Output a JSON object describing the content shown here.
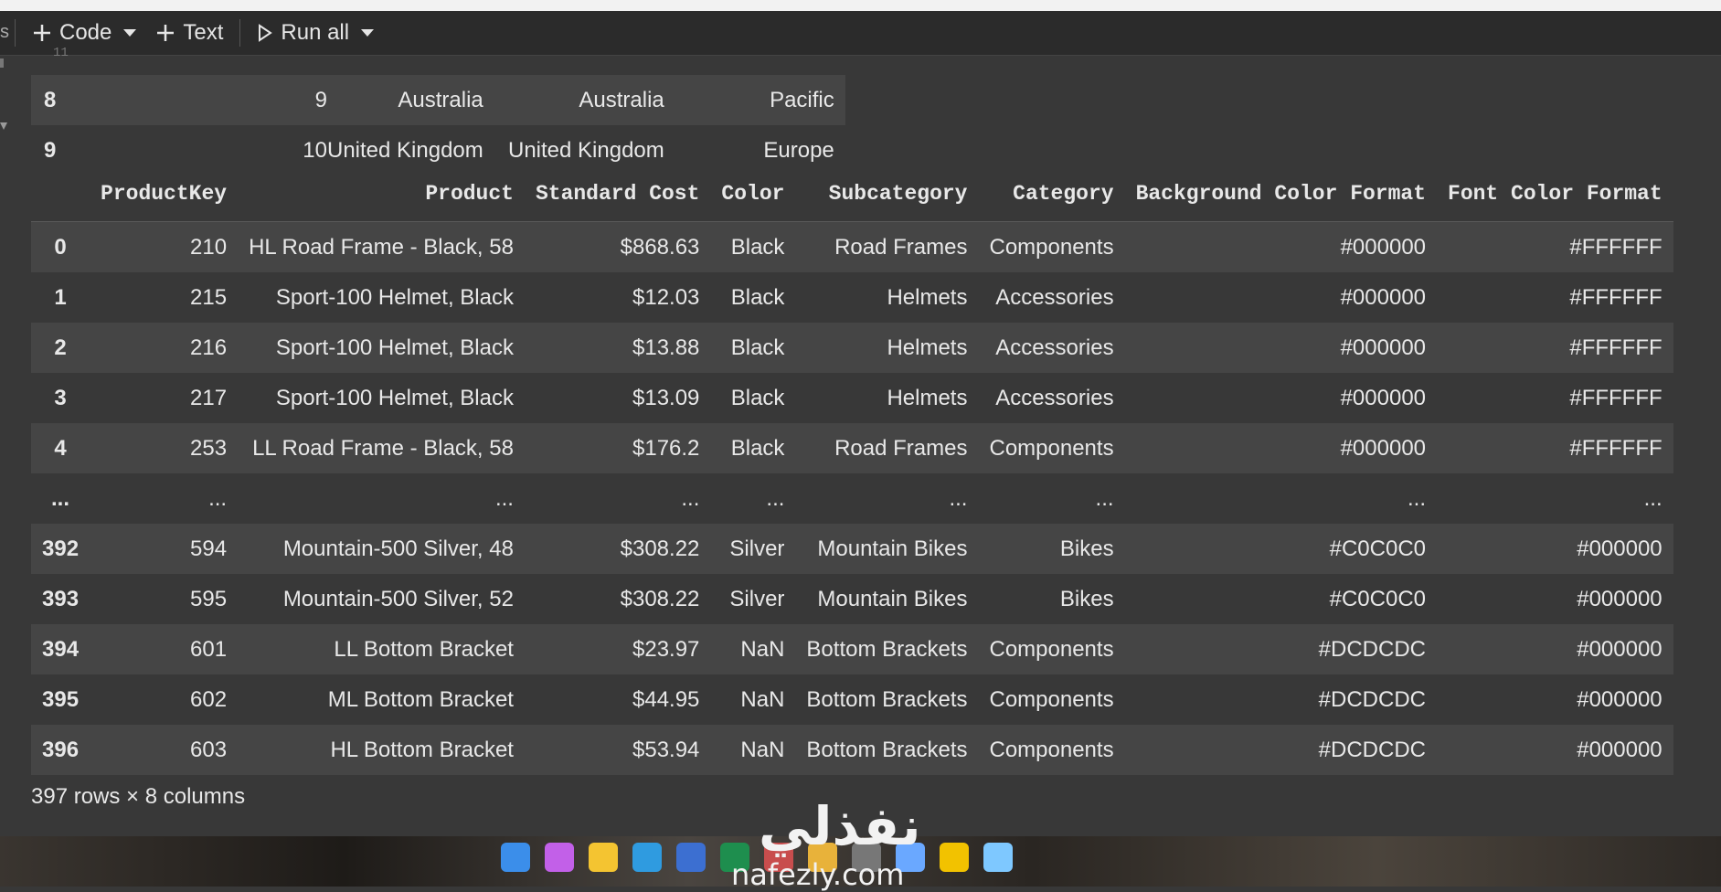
{
  "toolbar": {
    "code_label": "Code",
    "text_label": "Text",
    "run_all_label": "Run all",
    "edge_glyph": "s"
  },
  "cell_number": "11",
  "top_rows": [
    {
      "idx": "8",
      "key": "9",
      "country": "Australia",
      "region": "Australia",
      "group": "Pacific"
    },
    {
      "idx": "9",
      "key": "10",
      "country": "United Kingdom",
      "region": "United Kingdom",
      "group": "Europe"
    }
  ],
  "table": {
    "headers": [
      "ProductKey",
      "Product",
      "Standard Cost",
      "Color",
      "Subcategory",
      "Category",
      "Background Color Format",
      "Font Color Format"
    ],
    "rows": [
      [
        "0",
        "210",
        "HL Road Frame - Black, 58",
        "$868.63",
        "Black",
        "Road Frames",
        "Components",
        "#000000",
        "#FFFFFF"
      ],
      [
        "1",
        "215",
        "Sport-100 Helmet, Black",
        "$12.03",
        "Black",
        "Helmets",
        "Accessories",
        "#000000",
        "#FFFFFF"
      ],
      [
        "2",
        "216",
        "Sport-100 Helmet, Black",
        "$13.88",
        "Black",
        "Helmets",
        "Accessories",
        "#000000",
        "#FFFFFF"
      ],
      [
        "3",
        "217",
        "Sport-100 Helmet, Black",
        "$13.09",
        "Black",
        "Helmets",
        "Accessories",
        "#000000",
        "#FFFFFF"
      ],
      [
        "4",
        "253",
        "LL Road Frame - Black, 58",
        "$176.2",
        "Black",
        "Road Frames",
        "Components",
        "#000000",
        "#FFFFFF"
      ],
      [
        "...",
        "...",
        "...",
        "...",
        "...",
        "...",
        "...",
        "...",
        "..."
      ],
      [
        "392",
        "594",
        "Mountain-500 Silver, 48",
        "$308.22",
        "Silver",
        "Mountain Bikes",
        "Bikes",
        "#C0C0C0",
        "#000000"
      ],
      [
        "393",
        "595",
        "Mountain-500 Silver, 52",
        "$308.22",
        "Silver",
        "Mountain Bikes",
        "Bikes",
        "#C0C0C0",
        "#000000"
      ],
      [
        "394",
        "601",
        "LL Bottom Bracket",
        "$23.97",
        "NaN",
        "Bottom Brackets",
        "Components",
        "#DCDCDC",
        "#000000"
      ],
      [
        "395",
        "602",
        "ML Bottom Bracket",
        "$44.95",
        "NaN",
        "Bottom Brackets",
        "Components",
        "#DCDCDC",
        "#000000"
      ],
      [
        "396",
        "603",
        "HL Bottom Bracket",
        "$53.94",
        "NaN",
        "Bottom Brackets",
        "Components",
        "#DCDCDC",
        "#000000"
      ]
    ]
  },
  "footer": "397 rows × 8 columns",
  "watermark": {
    "arabic": "نفذلي",
    "latin": "nafezly.com"
  },
  "taskbar_icons": [
    "windows-start-icon",
    "copilot-icon",
    "file-explorer-icon",
    "edge-icon",
    "store-icon",
    "excel-icon",
    "media-icon",
    "chrome-icon",
    "obs-icon",
    "gemini-icon",
    "powerbi-icon",
    "snowflake-icon"
  ]
}
